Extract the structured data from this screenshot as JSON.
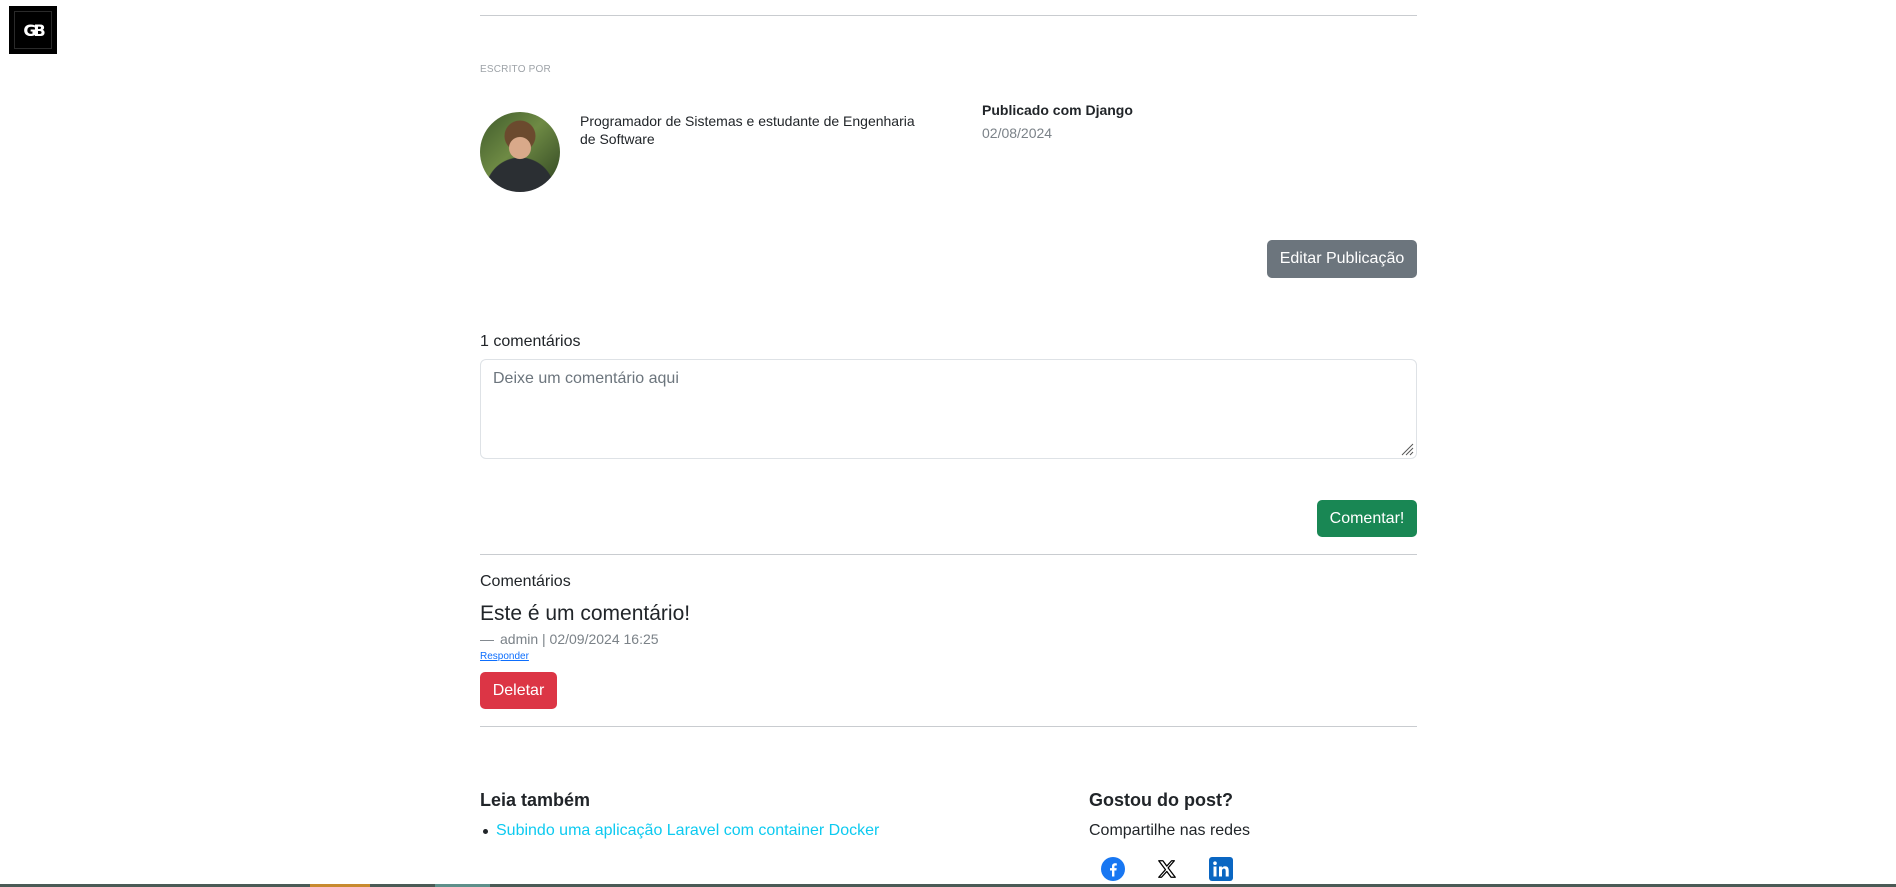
{
  "logo": {
    "text": "GB"
  },
  "author": {
    "written_by_label": "ESCRITO POR",
    "bio": "Programador de Sistemas e estudante de Engenharia de Software"
  },
  "post_meta": {
    "published_label": "Publicado com Django",
    "published_date": "02/08/2024"
  },
  "actions": {
    "edit_label": "Editar Publicação"
  },
  "comment_form": {
    "count_label": "1 comentários",
    "placeholder": "Deixe um comentário aqui",
    "value": "",
    "submit_label": "Comentar!"
  },
  "comments": {
    "heading": "Comentários",
    "items": [
      {
        "text": "Este é um comentário!",
        "dash": "—",
        "meta": "admin | 02/09/2024 16:25",
        "reply_label": "Responder",
        "delete_label": "Deletar"
      }
    ]
  },
  "read_also": {
    "title": "Leia também",
    "items": [
      {
        "label": "Subindo uma aplicação Laravel com container Docker"
      }
    ]
  },
  "share": {
    "title": "Gostou do post?",
    "subtitle": "Compartilhe nas redes",
    "networks": [
      {
        "icon": "facebook-icon",
        "color": "#1877f2"
      },
      {
        "icon": "x-icon",
        "color": "#000000"
      },
      {
        "icon": "linkedin-icon",
        "color": "#0a66c2"
      }
    ]
  },
  "colors": {
    "edit_button": "#6c757d",
    "comment_button": "#198754",
    "delete_button": "#dc3545",
    "link": "#0dcaf0",
    "reply_link": "#0d6efd"
  }
}
